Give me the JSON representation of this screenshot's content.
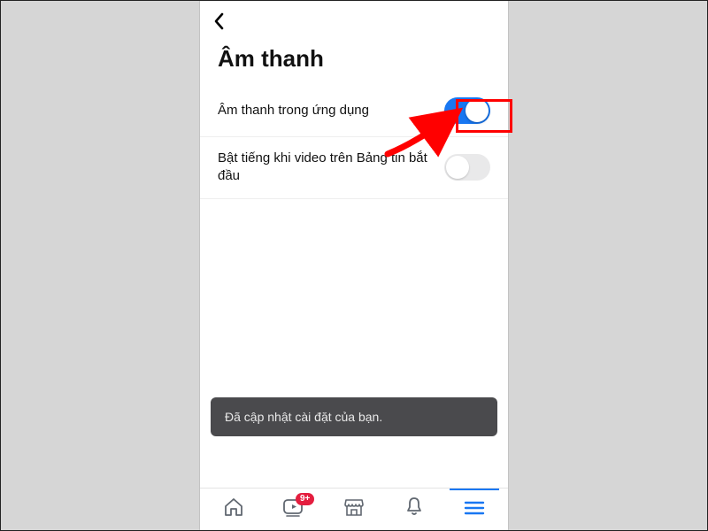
{
  "header": {
    "back_icon": "chevron-left"
  },
  "page_title": "Âm thanh",
  "settings": [
    {
      "label": "Âm thanh trong ứng dụng",
      "on": true,
      "highlighted": true
    },
    {
      "label": "Bật tiếng khi video trên Bảng tin bắt đầu",
      "on": false,
      "highlighted": false
    }
  ],
  "toast": {
    "message": "Đã cập nhật cài đặt của bạn."
  },
  "navbar": {
    "items": [
      {
        "name": "home",
        "badge": ""
      },
      {
        "name": "watch",
        "badge": "9+"
      },
      {
        "name": "marketplace",
        "badge": ""
      },
      {
        "name": "notifications",
        "badge": ""
      },
      {
        "name": "menu",
        "badge": "",
        "active": true
      }
    ]
  },
  "annotation": {
    "arrow_color": "#ff0000",
    "highlight_color": "#ff0000"
  }
}
